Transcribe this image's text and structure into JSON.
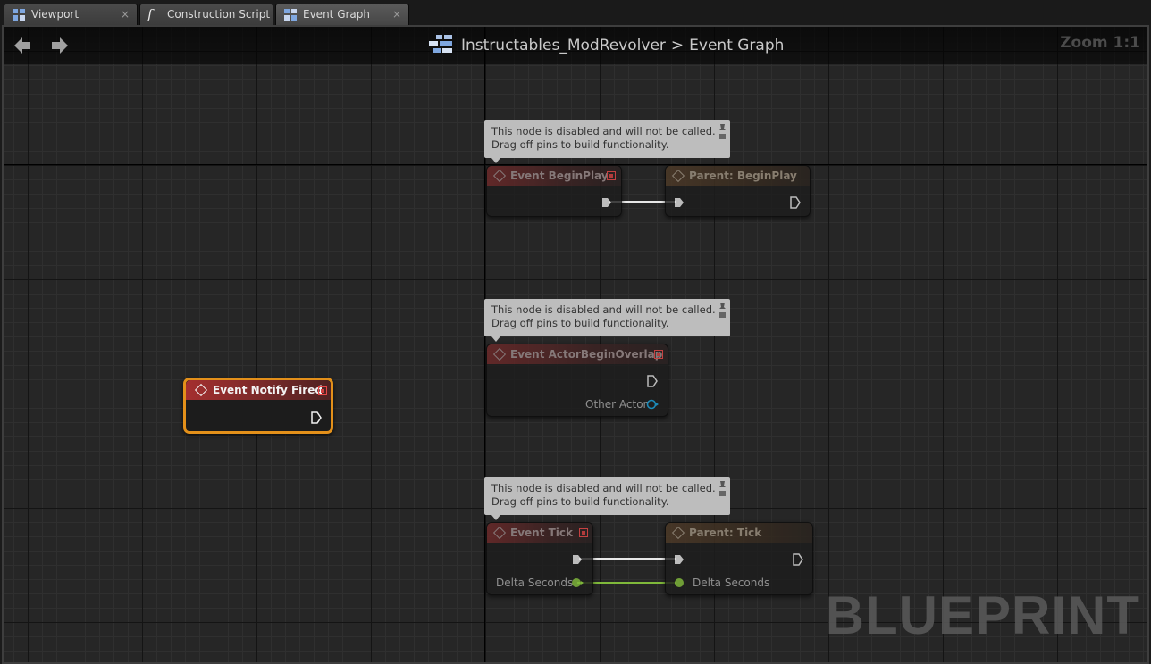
{
  "tabs": [
    {
      "label": "Viewport",
      "icon": "viewport-icon"
    },
    {
      "label": "Construction Script",
      "icon": "function-icon"
    },
    {
      "label": "Event Graph",
      "icon": "event-graph-icon",
      "active": true
    }
  ],
  "toolbar": {
    "breadcrumb_root": "Instructables_ModRevolver",
    "breadcrumb_separator": ">",
    "breadcrumb_current": "Event Graph",
    "zoom": "Zoom 1:1"
  },
  "watermark": "BLUEPRINT",
  "comments": {
    "disabled_text_1": "This node is disabled and will not be called.",
    "disabled_text_2": "Drag off pins to build functionality."
  },
  "nodes": {
    "begin_play": {
      "title": "Event BeginPlay"
    },
    "parent_begin_play": {
      "title": "Parent: BeginPlay"
    },
    "actor_begin_overlap": {
      "title": "Event ActorBeginOverlap",
      "pin_other_actor": "Other Actor"
    },
    "notify_fired": {
      "title": "Event Notify Fired"
    },
    "tick": {
      "title": "Event Tick",
      "pin_delta": "Delta Seconds"
    },
    "parent_tick": {
      "title": "Parent: Tick",
      "pin_delta": "Delta Seconds"
    }
  },
  "colors": {
    "exec_wire": "#ffffff",
    "float_wire": "#8bc34a",
    "selection": "#e3901a",
    "event_header": "#a42f2f",
    "object_pin": "#1aa0d8"
  }
}
